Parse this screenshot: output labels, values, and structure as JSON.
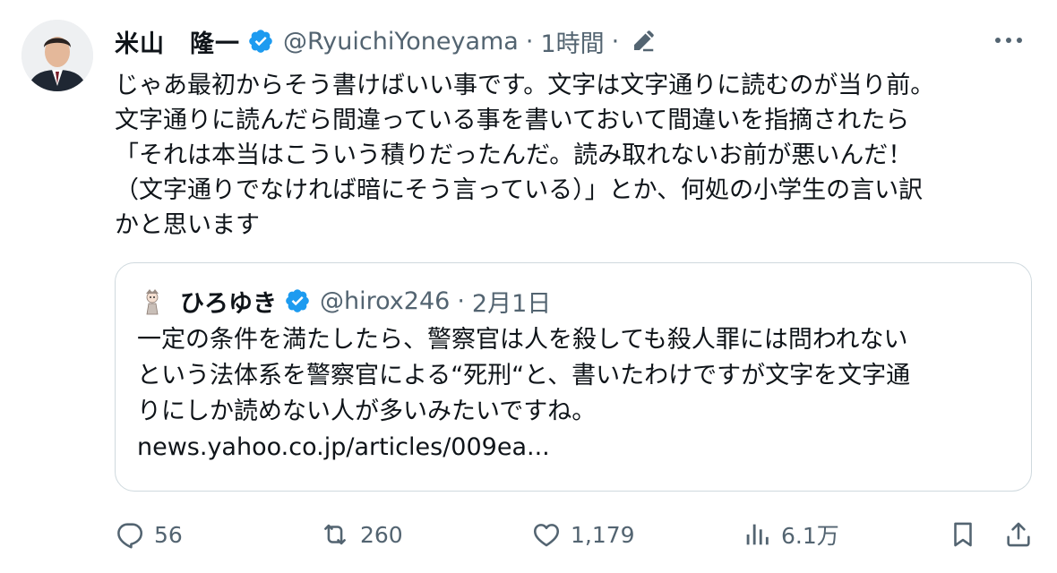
{
  "tweet": {
    "author_name": "米山　隆一",
    "handle": "@RyuichiYoneyama",
    "separator": "·",
    "time": "1時間",
    "lines": [
      "じゃあ最初からそう書けばいい事です。文字は文字通りに読むのが当り前。",
      "文字通りに読んだら間違っている事を書いておいて間違いを指摘されたら",
      "「それは本当はこういう積りだったんだ。読み取れないお前が悪いんだ！",
      "（文字通りでなければ暗にそう言っている）」とか、何処の小学生の言い訳",
      "かと思います"
    ],
    "icons": {
      "verified": "verified-badge-icon",
      "edit": "edit-pencil-icon",
      "more": "more-dots-icon"
    }
  },
  "quote": {
    "author_name": "ひろゆき",
    "handle": "@hirox246",
    "separator": "·",
    "date": "2月1日",
    "lines": [
      "一定の条件を満たしたら、警察官は人を殺しても殺人罪には問われない",
      "という法体系を警察官による“死刑“と、書いたわけですが文字を文字通",
      "りにしか読めない人が多いみたいですね。"
    ],
    "link": "news.yahoo.co.jp/articles/009ea..."
  },
  "actions": {
    "replies": "56",
    "retweets": "260",
    "likes": "1,179",
    "views": "6.1万"
  },
  "colors": {
    "accent_blue": "#1d9bf0",
    "text_primary": "#0f1419",
    "text_secondary": "#536471",
    "border": "#cfd9de"
  }
}
